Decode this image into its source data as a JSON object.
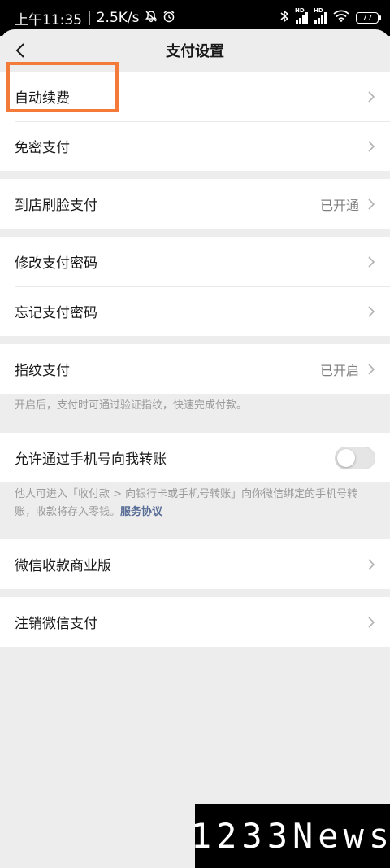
{
  "status_bar": {
    "time": "上午11:35",
    "separator": "|",
    "speed": "2.5K/s",
    "battery": "77",
    "icons": [
      "mute-bell-icon",
      "alarm-icon",
      "bluetooth-icon",
      "signal-hd-icon",
      "signal-hd-icon",
      "wifi-icon",
      "battery-icon"
    ]
  },
  "nav": {
    "title": "支付设置",
    "back_icon": "chevron-left-icon"
  },
  "groups": {
    "g1": {
      "auto_renew": "自动续费",
      "password_free": "免密支付"
    },
    "g2": {
      "face_pay": "到店刷脸支付",
      "face_pay_value": "已开通"
    },
    "g3": {
      "change_password": "修改支付密码",
      "forgot_password": "忘记支付密码"
    },
    "g4": {
      "fingerprint": "指纹支付",
      "fingerprint_value": "已开启",
      "fingerprint_note": "开启后，支付时可通过验证指纹，快速完成付款。"
    },
    "g5": {
      "phone_transfer": "允许通过手机号向我转账",
      "phone_transfer_enabled": false,
      "phone_transfer_note": "他人可进入「收付款 > 向银行卡或手机号转账」向你微信绑定的手机号转账，收款将存入零钱。",
      "service_link": "服务协议"
    },
    "g6": {
      "business": "微信收款商业版"
    },
    "g7": {
      "cancel": "注销微信支付"
    }
  },
  "watermark": "1233News",
  "colors": {
    "highlight": "#f47a3a",
    "link": "#576b95",
    "background": "#ededed"
  }
}
